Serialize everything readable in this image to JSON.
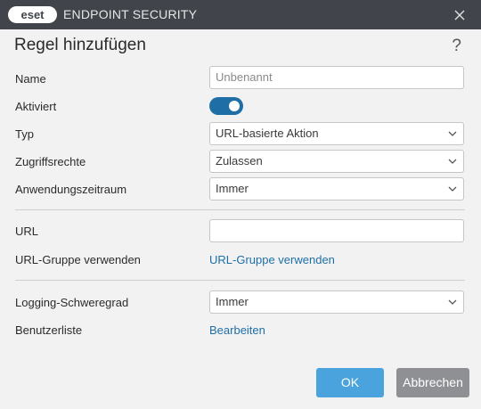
{
  "window": {
    "logo_text": "eset",
    "app_title": "ENDPOINT SECURITY"
  },
  "dialog": {
    "title": "Regel hinzufügen",
    "help": "?"
  },
  "form": {
    "name_label": "Name",
    "name_placeholder": "Unbenannt",
    "name_value": "",
    "enabled_label": "Aktiviert",
    "enabled_on": true,
    "type_label": "Typ",
    "type_value": "URL-basierte Aktion",
    "access_label": "Zugriffsrechte",
    "access_value": "Zulassen",
    "schedule_label": "Anwendungszeitraum",
    "schedule_value": "Immer",
    "url_label": "URL",
    "url_value": "",
    "url_group_label": "URL-Gruppe verwenden",
    "url_group_link": "URL-Gruppe verwenden",
    "logging_label": "Logging-Schweregrad",
    "logging_value": "Immer",
    "userlist_label": "Benutzerliste",
    "userlist_link": "Bearbeiten"
  },
  "buttons": {
    "ok": "OK",
    "cancel": "Abbrechen"
  },
  "colors": {
    "titlebar": "#41454b",
    "accent": "#1f6ea6",
    "link": "#1e6fa8",
    "ok_button": "#4aa3dc",
    "cancel_button": "#8e9094"
  },
  "icons": [
    "eset-logo-icon",
    "close-icon",
    "chevron-down-icon"
  ]
}
